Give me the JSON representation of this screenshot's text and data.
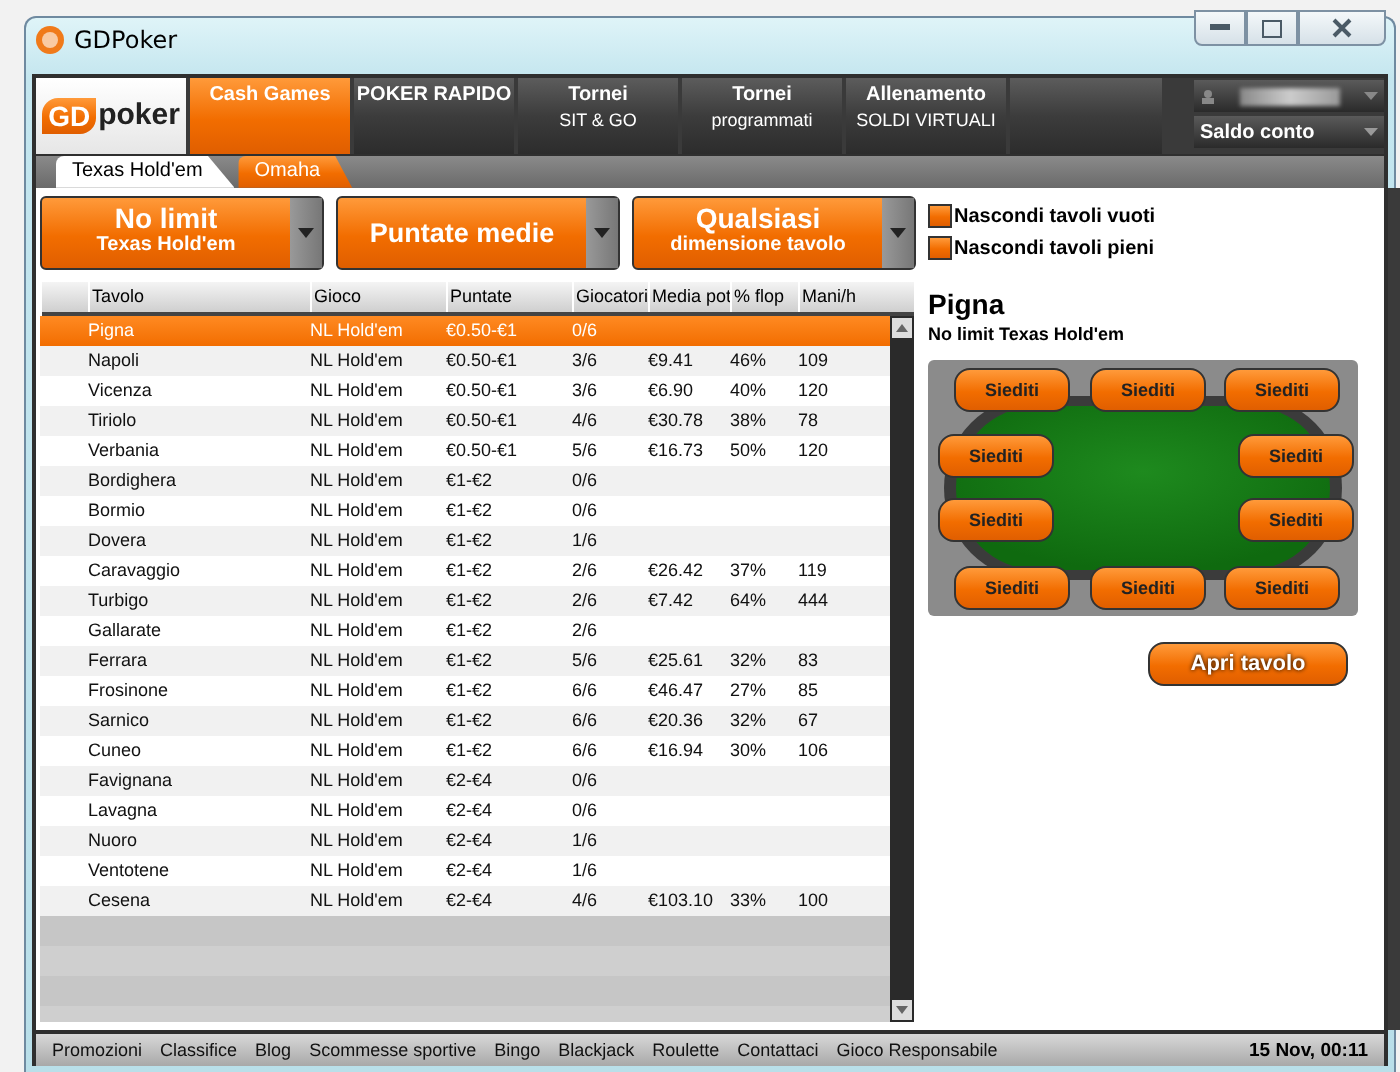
{
  "window": {
    "title": "GDPoker"
  },
  "logo": {
    "left": "GD",
    "right": "poker"
  },
  "main_tabs": [
    {
      "title": "Cash Games",
      "selected": true
    },
    {
      "title": "POKER RAPIDO",
      "selected": false
    },
    {
      "title": "Tornei",
      "subtitle": "SIT & GO",
      "selected": false
    },
    {
      "title": "Tornei",
      "subtitle": "programmati",
      "selected": false
    },
    {
      "title": "Allenamento",
      "subtitle": "SOLDI VIRTUALI",
      "selected": false
    }
  ],
  "account": {
    "balance_label": "Saldo conto"
  },
  "sub_tabs": [
    {
      "label": "Texas Hold'em",
      "selected": true
    },
    {
      "label": "Omaha",
      "selected": false
    }
  ],
  "filters": [
    {
      "title": "No limit",
      "subtitle": "Texas Hold'em"
    },
    {
      "title": "Puntate medie"
    },
    {
      "title": "Qualsiasi",
      "subtitle": "dimensione tavolo"
    }
  ],
  "options": [
    {
      "label": "Nascondi tavoli vuoti",
      "checked": false
    },
    {
      "label": "Nascondi tavoli pieni",
      "checked": false
    }
  ],
  "table": {
    "columns": [
      "Tavolo",
      "Gioco",
      "Puntate",
      "Giocatori",
      "Media pot",
      "% flop",
      "Mani/h"
    ],
    "rows": [
      {
        "cells": [
          "Pigna",
          "NL Hold'em",
          "€0.50-€1",
          "0/6"
        ],
        "selected": true
      },
      {
        "cells": [
          "Napoli",
          "NL Hold'em",
          "€0.50-€1",
          "3/6",
          "€9.41",
          "46%",
          "109"
        ],
        "selected": false
      },
      {
        "cells": [
          "Vicenza",
          "NL Hold'em",
          "€0.50-€1",
          "3/6",
          "€6.90",
          "40%",
          "120"
        ],
        "selected": false
      },
      {
        "cells": [
          "Tiriolo",
          "NL Hold'em",
          "€0.50-€1",
          "4/6",
          "€30.78",
          "38%",
          "78"
        ],
        "selected": false
      },
      {
        "cells": [
          "Verbania",
          "NL Hold'em",
          "€0.50-€1",
          "5/6",
          "€16.73",
          "50%",
          "120"
        ],
        "selected": false
      },
      {
        "cells": [
          "Bordighera",
          "NL Hold'em",
          "€1-€2",
          "0/6"
        ],
        "selected": false
      },
      {
        "cells": [
          "Bormio",
          "NL Hold'em",
          "€1-€2",
          "0/6"
        ],
        "selected": false
      },
      {
        "cells": [
          "Dovera",
          "NL Hold'em",
          "€1-€2",
          "1/6"
        ],
        "selected": false
      },
      {
        "cells": [
          "Caravaggio",
          "NL Hold'em",
          "€1-€2",
          "2/6",
          "€26.42",
          "37%",
          "119"
        ],
        "selected": false
      },
      {
        "cells": [
          "Turbigo",
          "NL Hold'em",
          "€1-€2",
          "2/6",
          "€7.42",
          "64%",
          "444"
        ],
        "selected": false
      },
      {
        "cells": [
          "Gallarate",
          "NL Hold'em",
          "€1-€2",
          "2/6"
        ],
        "selected": false
      },
      {
        "cells": [
          "Ferrara",
          "NL Hold'em",
          "€1-€2",
          "5/6",
          "€25.61",
          "32%",
          "83"
        ],
        "selected": false
      },
      {
        "cells": [
          "Frosinone",
          "NL Hold'em",
          "€1-€2",
          "6/6",
          "€46.47",
          "27%",
          "85"
        ],
        "selected": false
      },
      {
        "cells": [
          "Sarnico",
          "NL Hold'em",
          "€1-€2",
          "6/6",
          "€20.36",
          "32%",
          "67"
        ],
        "selected": false
      },
      {
        "cells": [
          "Cuneo",
          "NL Hold'em",
          "€1-€2",
          "6/6",
          "€16.94",
          "30%",
          "106"
        ],
        "selected": false
      },
      {
        "cells": [
          "Favignana",
          "NL Hold'em",
          "€2-€4",
          "0/6"
        ],
        "selected": false
      },
      {
        "cells": [
          "Lavagna",
          "NL Hold'em",
          "€2-€4",
          "0/6"
        ],
        "selected": false
      },
      {
        "cells": [
          "Nuoro",
          "NL Hold'em",
          "€2-€4",
          "1/6"
        ],
        "selected": false
      },
      {
        "cells": [
          "Ventotene",
          "NL Hold'em",
          "€2-€4",
          "1/6"
        ],
        "selected": false
      },
      {
        "cells": [
          "Cesena",
          "NL Hold'em",
          "€2-€4",
          "4/6",
          "€103.10",
          "33%",
          "100"
        ],
        "selected": false
      }
    ]
  },
  "preview": {
    "title": "Pigna",
    "subtitle": "No limit Texas Hold'em",
    "seats": [
      "Siediti",
      "Siediti",
      "Siediti",
      "Siediti",
      "Siediti",
      "Siediti",
      "Siediti",
      "Siediti",
      "Siediti",
      "Siediti"
    ],
    "open_button": "Apri tavolo"
  },
  "footer": {
    "links": [
      "Promozioni",
      "Classifice",
      "Blog",
      "Scommesse sportive",
      "Bingo",
      "Blackjack",
      "Roulette",
      "Contattaci",
      "Gioco Responsabile"
    ],
    "datetime": "15 Nov, 00:11"
  }
}
